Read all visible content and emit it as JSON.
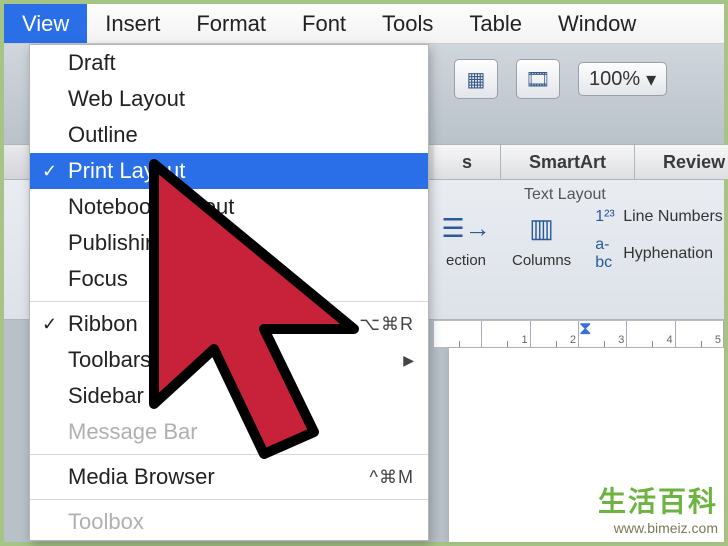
{
  "menubar": {
    "items": [
      {
        "label": "View",
        "active": true
      },
      {
        "label": "Insert"
      },
      {
        "label": "Format"
      },
      {
        "label": "Font"
      },
      {
        "label": "Tools"
      },
      {
        "label": "Table"
      },
      {
        "label": "Window"
      }
    ]
  },
  "dropdown": {
    "groups": [
      [
        {
          "label": "Draft"
        },
        {
          "label": "Web Layout"
        },
        {
          "label": "Outline"
        },
        {
          "label": "Print Layout",
          "checked": true,
          "selected": true
        },
        {
          "label": "Notebook Layout"
        },
        {
          "label": "Publishing Layout"
        },
        {
          "label": "Focus"
        }
      ],
      [
        {
          "label": "Ribbon",
          "checked": true,
          "shortcut": "⌥⌘R"
        },
        {
          "label": "Toolbars",
          "submenu": true
        },
        {
          "label": "Sidebar"
        },
        {
          "label": "Message Bar",
          "disabled": true
        }
      ],
      [
        {
          "label": "Media Browser",
          "shortcut": "^⌘M"
        }
      ],
      [
        {
          "label": "Toolbox",
          "disabled": true
        }
      ]
    ]
  },
  "toolbar": {
    "zoom": "100%"
  },
  "tabs": {
    "items": [
      {
        "label": "s"
      },
      {
        "label": "SmartArt"
      },
      {
        "label": "Review"
      }
    ]
  },
  "ribbon": {
    "group_label": "Text Layout",
    "direction_label": "ection",
    "columns_label": "Columns",
    "line_numbers_label": "Line Numbers",
    "hyphenation_label": "Hyphenation"
  },
  "ruler": {
    "ticks": [
      "",
      "1",
      "2",
      "3",
      "4",
      "5"
    ]
  },
  "watermark": {
    "title": "生活百科",
    "url": "www.bimeiz.com"
  }
}
